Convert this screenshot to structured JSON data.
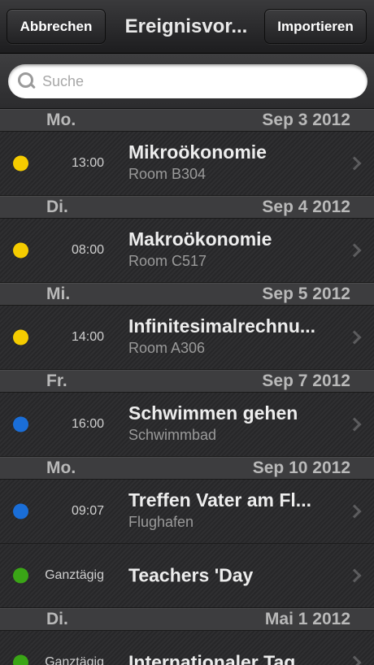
{
  "navbar": {
    "cancel_label": "Abbrechen",
    "title": "Ereignisvor...",
    "import_label": "Importieren"
  },
  "search": {
    "placeholder": "Suche"
  },
  "colors": {
    "yellow": "#f5cc00",
    "blue": "#1a6ed8",
    "green": "#3aa516"
  },
  "sections": [
    {
      "day": "Mo.",
      "date": "Sep 3 2012",
      "events": [
        {
          "time": "13:00",
          "title": "Mikroökonomie",
          "location": "Room B304",
          "color": "yellow"
        }
      ]
    },
    {
      "day": "Di.",
      "date": "Sep 4 2012",
      "events": [
        {
          "time": "08:00",
          "title": "Makroökonomie",
          "location": "Room C517",
          "color": "yellow"
        }
      ]
    },
    {
      "day": "Mi.",
      "date": "Sep 5 2012",
      "events": [
        {
          "time": "14:00",
          "title": "Infinitesimalrechnu...",
          "location": "Room A306",
          "color": "yellow"
        }
      ]
    },
    {
      "day": "Fr.",
      "date": "Sep 7 2012",
      "events": [
        {
          "time": "16:00",
          "title": "Schwimmen gehen",
          "location": "Schwimmbad",
          "color": "blue"
        }
      ]
    },
    {
      "day": "Mo.",
      "date": "Sep 10 2012",
      "events": [
        {
          "time": "09:07",
          "title": "Treffen Vater am Fl...",
          "location": "Flughafen",
          "color": "blue"
        },
        {
          "time": "Ganztägig",
          "title": "Teachers 'Day",
          "location": "",
          "color": "green"
        }
      ]
    },
    {
      "day": "Di.",
      "date": "Mai 1 2012",
      "events": [
        {
          "time": "Ganztägig",
          "title": "Internationaler Tag...",
          "location": "",
          "color": "green"
        }
      ]
    }
  ]
}
